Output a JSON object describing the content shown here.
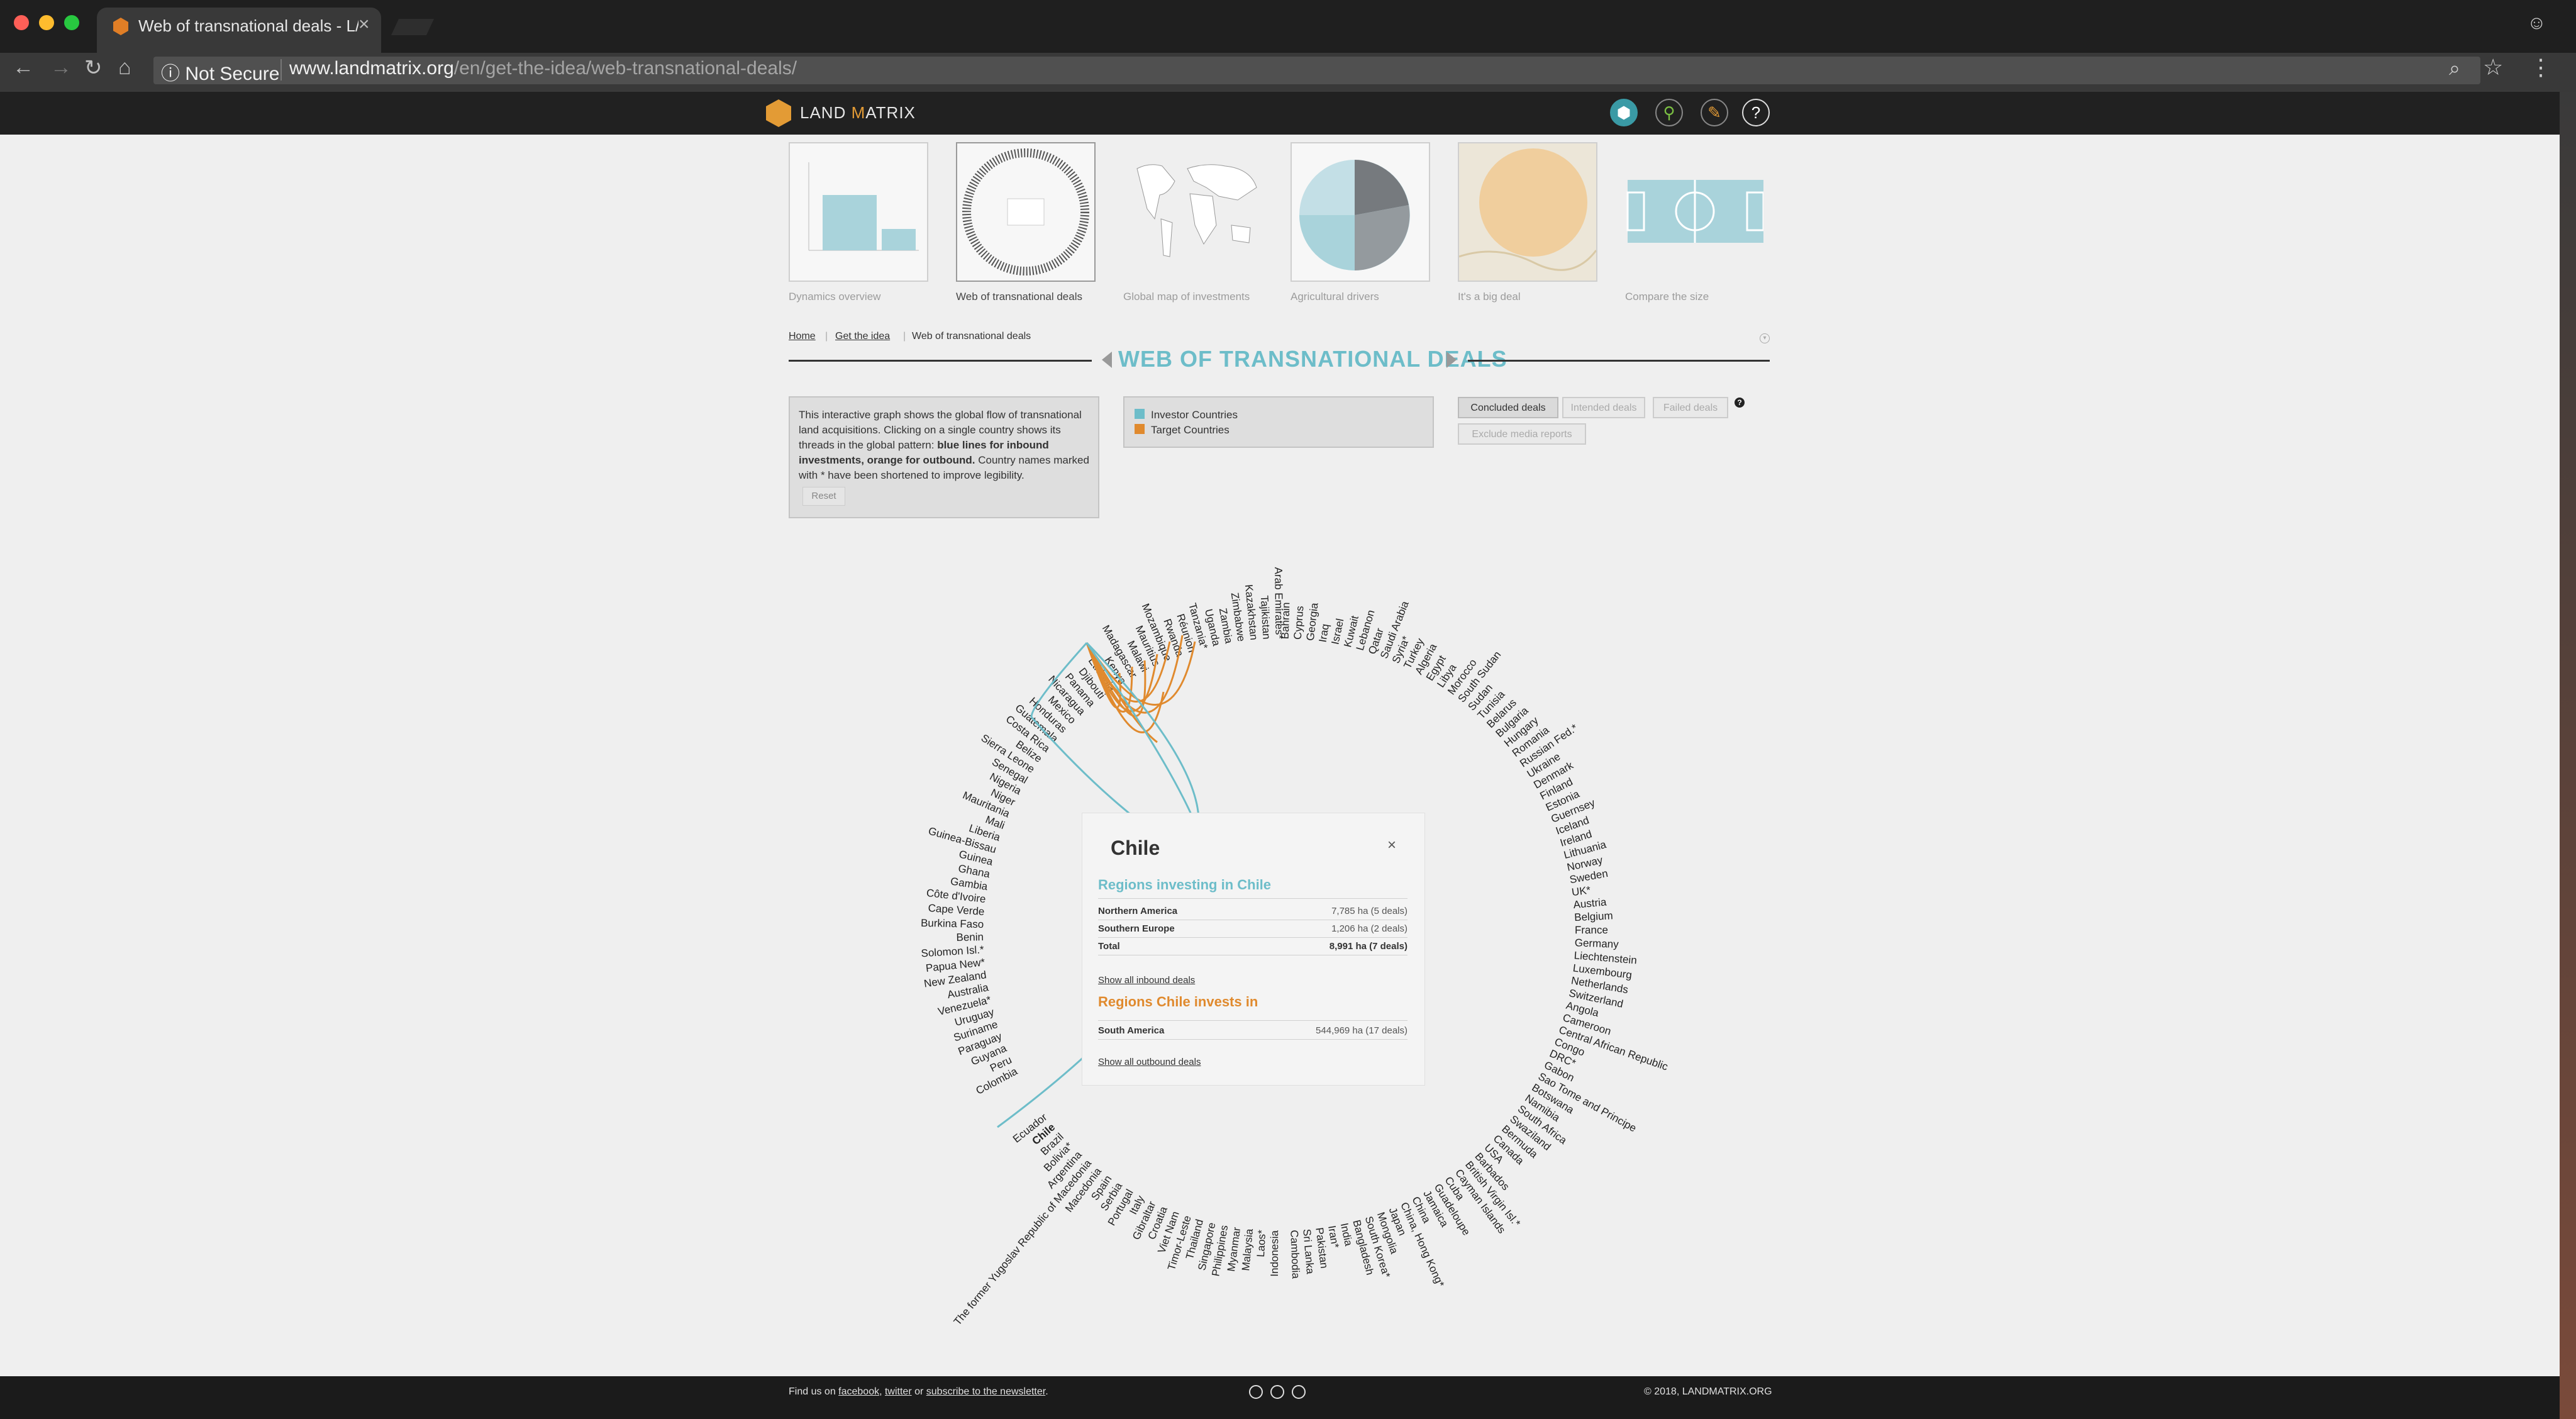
{
  "browser": {
    "tab_title": "Web of transnational deals - L/",
    "security": "Not Secure",
    "url_host": "www.landmatrix.org",
    "url_path": "/en/get-the-idea/web-transnational-deals/"
  },
  "site": {
    "logo_text_a": "LAND ",
    "logo_text_b": "M",
    "logo_text_c": "ATRIX",
    "header_icons": [
      "map-icon",
      "search-icon",
      "pencil-icon",
      "help-icon"
    ],
    "help_glyph": "?"
  },
  "thumbnails": [
    {
      "label": "Dynamics overview"
    },
    {
      "label": "Web of transnational deals"
    },
    {
      "label": "Global map of investments"
    },
    {
      "label": "Agricultural drivers"
    },
    {
      "label": "It's a big deal"
    },
    {
      "label": "Compare the size"
    }
  ],
  "breadcrumb": {
    "home": "Home",
    "sep": "|",
    "get_idea": "Get the idea",
    "current": "Web of transnational deals"
  },
  "page_title": "WEB OF TRANSNATIONAL DEALS",
  "info": {
    "text_1": "This interactive graph shows the global flow of transnational land acquisitions. Clicking on a single country shows its threads in the global pattern: ",
    "text_bold": "blue lines for inbound investments, orange for outbound.",
    "text_2": " Country names marked with * have been shortened to improve legibility.",
    "reset": "Reset"
  },
  "legend": {
    "investor": "Investor Countries",
    "target": "Target Countries",
    "investor_color": "#6dbdc9",
    "target_color": "#e08a2e"
  },
  "filters": {
    "concluded": "Concluded deals",
    "intended": "Intended deals",
    "failed": "Failed deals",
    "exclude": "Exclude media reports",
    "help": "?"
  },
  "popup": {
    "title": "Chile",
    "close": "×",
    "inbound_heading": "Regions investing in Chile",
    "inbound_rows": [
      {
        "region": "Northern America",
        "value": "7,785 ha (5 deals)"
      },
      {
        "region": "Southern Europe",
        "value": "1,206 ha (2 deals)"
      }
    ],
    "inbound_total_label": "Total",
    "inbound_total_value": "8,991 ha (7 deals)",
    "inbound_link": "Show all inbound deals",
    "outbound_heading": "Regions Chile invests in",
    "outbound_rows": [
      {
        "region": "South America",
        "value": "544,969 ha (17 deals)"
      }
    ],
    "outbound_link": "Show all outbound deals"
  },
  "countries": [
    "Colombia",
    "Peru",
    "Guyana",
    "Paraguay",
    "Suriname",
    "Uruguay",
    "Venezuela*",
    "Australia",
    "New Zealand",
    "Papua New*",
    "Solomon Isl.*",
    "Benin",
    "Burkina Faso",
    "Cape Verde",
    "Côte d'Ivoire",
    "Gambia",
    "Ghana",
    "Guinea",
    "Guinea-Bissau",
    "Liberia",
    "Mali",
    "Mauritania",
    "Niger",
    "Nigeria",
    "Senegal",
    "Sierra Leone",
    "Belize",
    "Costa Rica",
    "Guatemala",
    "Honduras",
    "Mexico",
    "Nicaragua",
    "Panama",
    "Djibouti",
    "Ethiopia",
    "Kenya",
    "Madagascar",
    "Malawi",
    "Mauritius",
    "Mozambique",
    "Rwanda",
    "Réunion",
    "Tanzania*",
    "Uganda",
    "Zambia",
    "Zimbabwe",
    "Kazakhstan",
    "Tajikistan",
    "Arab Emirates*",
    "Bahrain",
    "Cyprus",
    "Georgia",
    "Iraq",
    "Israel",
    "Kuwait",
    "Lebanon",
    "Qatar",
    "Saudi Arabia",
    "Syria*",
    "Turkey",
    "Algeria",
    "Egypt",
    "Libya",
    "Morocco",
    "South Sudan",
    "Sudan",
    "Tunisia",
    "Belarus",
    "Bulgaria",
    "Hungary",
    "Romania",
    "Russian Fed.*",
    "Ukraine",
    "Denmark",
    "Finland",
    "Estonia",
    "Guernsey",
    "Iceland",
    "Ireland",
    "Lithuania",
    "Norway",
    "Sweden",
    "UK*",
    "Austria",
    "Belgium",
    "France",
    "Germany",
    "Liechtenstein",
    "Luxembourg",
    "Netherlands",
    "Switzerland",
    "Angola",
    "Cameroon",
    "Central African Republic",
    "Congo",
    "DRC*",
    "Gabon",
    "Sao Tome and Principe",
    "Botswana",
    "Namibia",
    "South Africa",
    "Swaziland",
    "Bermuda",
    "Canada",
    "USA",
    "Barbados",
    "British Virgin Isl.*",
    "Cayman Islands",
    "Cuba",
    "Guadeloupe",
    "Jamaica",
    "China",
    "China, Hong Kong*",
    "Japan",
    "Mongolia",
    "South Korea*",
    "Bangladesh",
    "India",
    "Iran*",
    "Pakistan",
    "Sri Lanka",
    "Cambodia",
    "Indonesia",
    "Laos*",
    "Malaysia",
    "Myanmar",
    "Philippines",
    "Singapore",
    "Thailand",
    "Timor-Leste",
    "Viet Nam",
    "Croatia",
    "Gibraltar",
    "Italy",
    "Portugal",
    "Serbia",
    "Spain",
    "Macedonia",
    "The former Yugoslav Republic of Macedonia",
    "Argentina",
    "Bolivia*",
    "Brazil",
    "Chile",
    "Ecuador"
  ],
  "footer": {
    "find_us": "Find us on ",
    "facebook": "facebook",
    "comma": ", ",
    "twitter": "twitter",
    "or": " or ",
    "newsletter": "subscribe to the newsletter",
    "period": ".",
    "copyright": "© 2018, LANDMATRIX.ORG"
  }
}
